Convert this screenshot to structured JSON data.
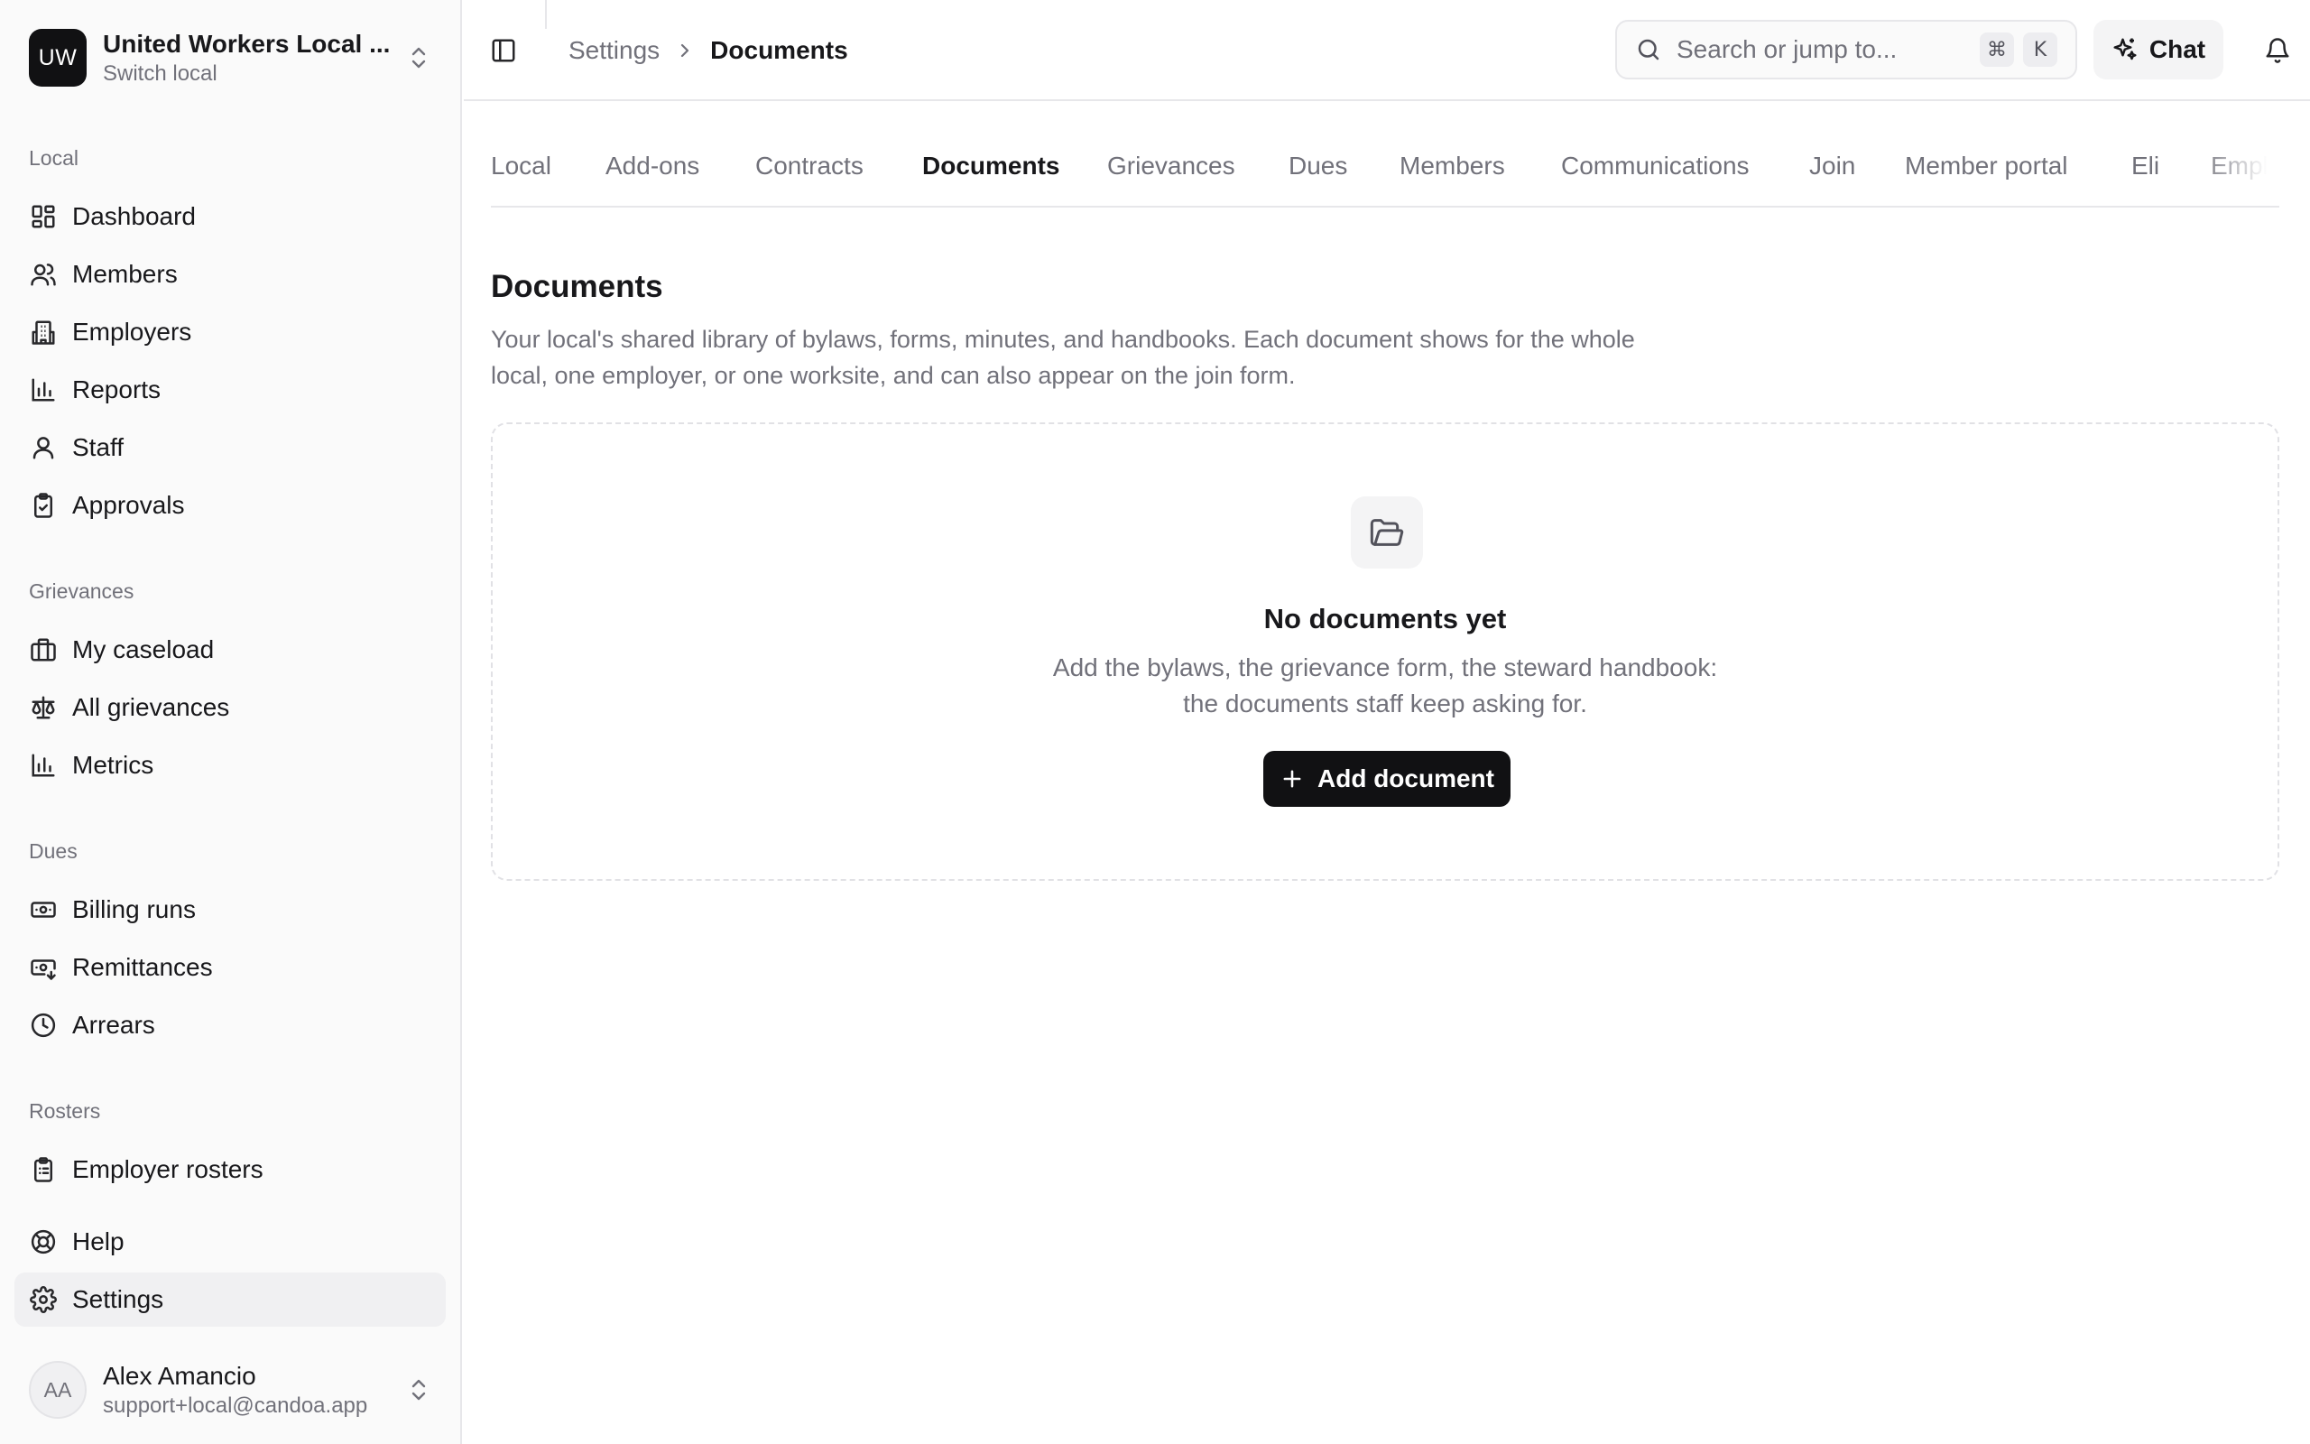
{
  "local": {
    "initials": "UW",
    "name": "United Workers Local ...",
    "subtitle": "Switch local"
  },
  "sidebar": {
    "sections": [
      {
        "label": "Local",
        "items": [
          {
            "label": "Dashboard",
            "icon": "dashboard-icon"
          },
          {
            "label": "Members",
            "icon": "users-icon"
          },
          {
            "label": "Employers",
            "icon": "building-icon"
          },
          {
            "label": "Reports",
            "icon": "bar-chart-icon"
          },
          {
            "label": "Staff",
            "icon": "user-icon"
          },
          {
            "label": "Approvals",
            "icon": "clipboard-check-icon"
          }
        ]
      },
      {
        "label": "Grievances",
        "items": [
          {
            "label": "My caseload",
            "icon": "briefcase-icon"
          },
          {
            "label": "All grievances",
            "icon": "scale-icon"
          },
          {
            "label": "Metrics",
            "icon": "bar-chart-icon"
          }
        ]
      },
      {
        "label": "Dues",
        "items": [
          {
            "label": "Billing runs",
            "icon": "banknote-icon"
          },
          {
            "label": "Remittances",
            "icon": "banknote-arrow-icon"
          },
          {
            "label": "Arrears",
            "icon": "clock-icon"
          }
        ]
      },
      {
        "label": "Rosters",
        "items": [
          {
            "label": "Employer rosters",
            "icon": "clipboard-list-icon"
          }
        ]
      }
    ],
    "footer_items": [
      {
        "label": "Help",
        "icon": "lifebuoy-icon"
      },
      {
        "label": "Settings",
        "icon": "gear-icon",
        "active": true
      }
    ]
  },
  "user": {
    "initials": "AA",
    "name": "Alex Amancio",
    "email": "support+local@candoa.app"
  },
  "breadcrumb": {
    "parent": "Settings",
    "current": "Documents"
  },
  "search": {
    "placeholder": "Search or jump to...",
    "shortcut_mod": "⌘",
    "shortcut_key": "K"
  },
  "header": {
    "chat_label": "Chat"
  },
  "tabs": [
    {
      "label": "Local"
    },
    {
      "label": "Add-ons"
    },
    {
      "label": "Contracts"
    },
    {
      "label": "Documents",
      "active": true
    },
    {
      "label": "Grievances"
    },
    {
      "label": "Dues"
    },
    {
      "label": "Members"
    },
    {
      "label": "Communications"
    },
    {
      "label": "Join"
    },
    {
      "label": "Member portal"
    },
    {
      "label": "Eli"
    },
    {
      "label": "Emplo"
    }
  ],
  "page": {
    "title": "Documents",
    "description": "Your local's shared library of bylaws, forms, minutes, and handbooks. Each document shows for the whole local, one employer, or one worksite, and can also appear on the join form."
  },
  "empty_state": {
    "icon": "folder-open-icon",
    "title": "No documents yet",
    "line1": "Add the bylaws, the grievance form, the steward handbook:",
    "line2": "the documents staff keep asking for.",
    "button_label": "Add document"
  }
}
